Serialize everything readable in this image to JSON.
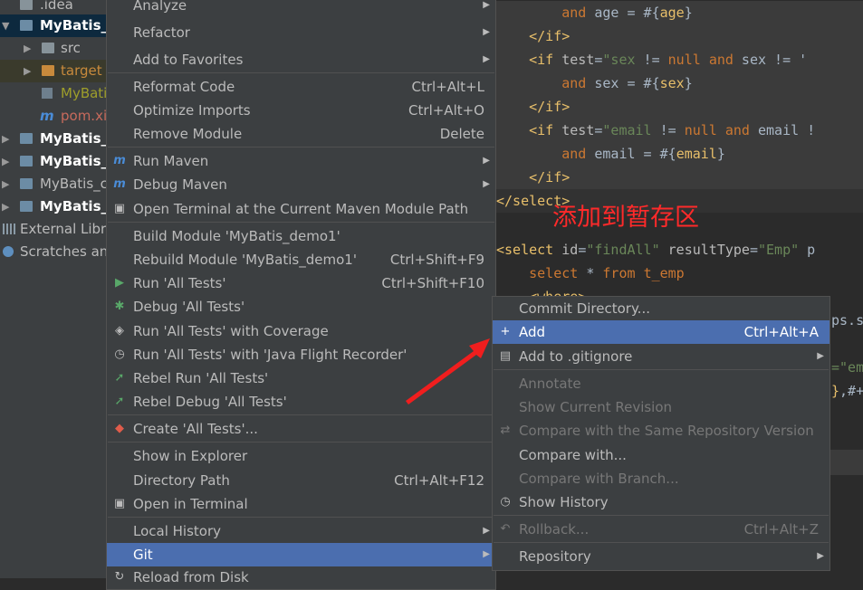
{
  "tree": {
    "items": [
      {
        "label": ".idea",
        "color": "#bbbbbb"
      },
      {
        "label": "MyBatis_c",
        "color": "#ffffff"
      },
      {
        "label": "src",
        "color": "#bbbbbb"
      },
      {
        "label": "target",
        "color": "#c88a3c"
      },
      {
        "label": "MyBati",
        "color": "#9e9e2b"
      },
      {
        "label": "pom.xi",
        "color": "#c86a5c"
      },
      {
        "label": "MyBatis_c",
        "color": "#ffffff"
      },
      {
        "label": "MyBatis_c",
        "color": "#ffffff"
      },
      {
        "label": "MyBatis_c",
        "color": "#bbbbbb"
      },
      {
        "label": "MyBatis_I",
        "color": "#ffffff"
      },
      {
        "label": "External Libra",
        "color": "#bbbbbb"
      },
      {
        "label": "Scratches and",
        "color": "#bbbbbb"
      }
    ]
  },
  "editor": {
    "annotation": "添加到暂存区",
    "annotation_color": "#ff2a2a"
  },
  "context_menu": {
    "items": [
      {
        "label": "Analyze",
        "shortcut": "",
        "submenu": true
      },
      {
        "label": "Refactor",
        "shortcut": "",
        "submenu": true
      },
      {
        "label": "Add to Favorites",
        "shortcut": "",
        "submenu": true
      },
      {
        "label": "Reformat Code",
        "shortcut": "Ctrl+Alt+L"
      },
      {
        "label": "Optimize Imports",
        "shortcut": "Ctrl+Alt+O"
      },
      {
        "label": "Remove Module",
        "shortcut": "Delete"
      },
      {
        "label": "Run Maven",
        "shortcut": "",
        "submenu": true,
        "icon": "maven-icon"
      },
      {
        "label": "Debug Maven",
        "shortcut": "",
        "submenu": true,
        "icon": "maven-icon"
      },
      {
        "label": "Open Terminal at the Current Maven Module Path",
        "shortcut": "",
        "icon": "terminal-maven-icon"
      },
      {
        "label": "Build Module 'MyBatis_demo1'",
        "shortcut": ""
      },
      {
        "label": "Rebuild Module 'MyBatis_demo1'",
        "shortcut": "Ctrl+Shift+F9"
      },
      {
        "label": "Run 'All Tests'",
        "shortcut": "Ctrl+Shift+F10",
        "icon": "run-icon"
      },
      {
        "label": "Debug 'All Tests'",
        "shortcut": "",
        "icon": "debug-icon"
      },
      {
        "label": "Run 'All Tests' with Coverage",
        "shortcut": "",
        "icon": "coverage-icon"
      },
      {
        "label": "Run 'All Tests' with 'Java Flight Recorder'",
        "shortcut": "",
        "icon": "profiler-icon"
      },
      {
        "label": "Rebel Run 'All Tests'",
        "shortcut": "",
        "icon": "rebel-run-icon"
      },
      {
        "label": "Rebel Debug 'All Tests'",
        "shortcut": "",
        "icon": "rebel-debug-icon"
      },
      {
        "label": "Create 'All Tests'...",
        "shortcut": "",
        "icon": "create-config-icon"
      },
      {
        "label": "Show in Explorer",
        "shortcut": ""
      },
      {
        "label": "Directory Path",
        "shortcut": "Ctrl+Alt+F12"
      },
      {
        "label": "Open in Terminal",
        "shortcut": "",
        "icon": "terminal-icon"
      },
      {
        "label": "Local History",
        "shortcut": "",
        "submenu": true
      },
      {
        "label": "Git",
        "shortcut": "",
        "submenu": true,
        "selected": true
      },
      {
        "label": "Reload from Disk",
        "shortcut": "",
        "icon": "reload-icon"
      }
    ]
  },
  "git_menu": {
    "items": [
      {
        "label": "Commit Directory...",
        "shortcut": ""
      },
      {
        "label": "Add",
        "shortcut": "Ctrl+Alt+A",
        "selected": true,
        "icon": "plus-icon"
      },
      {
        "label": "Add to .gitignore",
        "shortcut": "",
        "submenu": true,
        "icon": "gitignore-icon"
      },
      {
        "label": "Annotate",
        "shortcut": "",
        "disabled": true
      },
      {
        "label": "Show Current Revision",
        "shortcut": "",
        "disabled": true
      },
      {
        "label": "Compare with the Same Repository Version",
        "shortcut": "",
        "disabled": true,
        "icon": "compare-icon"
      },
      {
        "label": "Compare with...",
        "shortcut": ""
      },
      {
        "label": "Compare with Branch...",
        "shortcut": "",
        "disabled": true
      },
      {
        "label": "Show History",
        "shortcut": "",
        "icon": "clock-icon"
      },
      {
        "label": "Rollback...",
        "shortcut": "Ctrl+Alt+Z",
        "disabled": true,
        "icon": "rollback-icon"
      },
      {
        "label": "Repository",
        "shortcut": "",
        "submenu": true
      }
    ]
  }
}
